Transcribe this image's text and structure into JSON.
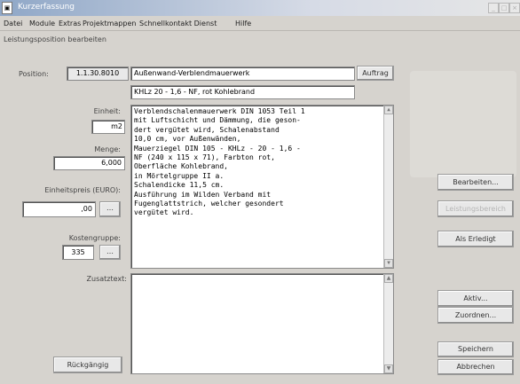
{
  "window": {
    "title": "Kurzerfassung"
  },
  "menu": [
    "Datei",
    "Module",
    "Extras",
    "Projektmappen",
    "Schnellkontakt Dienst",
    "Hilfe"
  ],
  "section_title": "Leistungsposition bearbeiten",
  "position": {
    "label": "Position:",
    "number": "1.1.30.8010",
    "name": "Außenwand-Verblendmauerwerk",
    "auftrag_label": "Auftrag",
    "short_text": "KHLz 20 - 1,6 - NF, rot Kohlebrand"
  },
  "fields": {
    "einheit_label": "Einheit:",
    "einheit_value": "m2",
    "menge_label": "Menge:",
    "menge_value": "6,000",
    "ep_label": "Einheitspreis (EURO):",
    "ep_value": ",00",
    "kg_label": "Kostengruppe:",
    "kg_value": "335",
    "zusatz_label": "Zusatztext:"
  },
  "longtext_lines": [
    "Verblendschalenmauerwerk DIN 1053 Teil 1",
    "mit Luftschicht und Dämmung, die geson-",
    "dert vergütet wird, Schalenabstand",
    "10,0 cm, vor Außenwänden,",
    "Mauerziegel DIN 105 - KHLz - 20 - 1,6 -",
    "NF (240 x 115 x 71), Farbton rot,",
    "Oberfläche Kohlebrand,",
    "in Mörtelgruppe II a.",
    "Schalendicke 11,5 cm.",
    "Ausführung im Wilden Verband mit",
    "Fugenglattstrich, welcher gesondert",
    "vergütet wird."
  ],
  "buttons": {
    "bearbeiten": "Bearbeiten...",
    "disabled": "Leistungsbereich",
    "erledigt": "Als Erledigt",
    "aktiv": "Aktiv...",
    "zuordnen": "Zuordnen...",
    "speichern": "Speichern",
    "abbrechen": "Abbrechen",
    "rueckgaengig": "Rückgängig"
  },
  "colors": {
    "background": "#d6d3ce",
    "titlebar": "#8fa7c7"
  }
}
